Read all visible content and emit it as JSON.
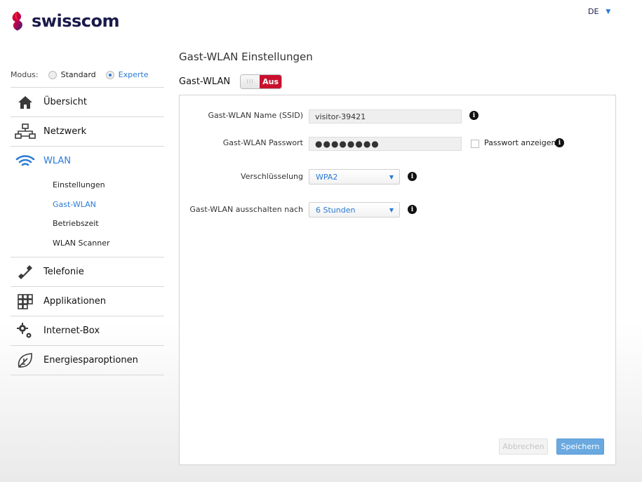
{
  "brand": {
    "name": "swisscom"
  },
  "lang": {
    "current": "DE"
  },
  "mode": {
    "label": "Modus:",
    "standard": "Standard",
    "expert": "Experte",
    "selected": "expert"
  },
  "sidebar": {
    "items": [
      {
        "label": "Übersicht",
        "icon": "home-icon"
      },
      {
        "label": "Netzwerk",
        "icon": "network-icon"
      },
      {
        "label": "WLAN",
        "icon": "wifi-icon",
        "active": true,
        "subitems": [
          {
            "label": "Einstellungen"
          },
          {
            "label": "Gast-WLAN",
            "active": true
          },
          {
            "label": "Betriebszeit"
          },
          {
            "label": "WLAN Scanner"
          }
        ]
      },
      {
        "label": "Telefonie",
        "icon": "phone-icon"
      },
      {
        "label": "Applikationen",
        "icon": "apps-icon"
      },
      {
        "label": "Internet-Box",
        "icon": "gears-icon"
      },
      {
        "label": "Energiesparoptionen",
        "icon": "leaf-icon"
      }
    ]
  },
  "main": {
    "title": "Gast-WLAN Einstellungen",
    "toggle": {
      "label": "Gast-WLAN",
      "state": "Aus",
      "knob": "III"
    },
    "form": {
      "ssid": {
        "label": "Gast-WLAN Name (SSID)",
        "value": "visitor-39421"
      },
      "password": {
        "label": "Gast-WLAN Passwort",
        "value": "●●●●●●●●",
        "show_label": "Passwort anzeigen"
      },
      "encryption": {
        "label": "Verschlüsselung",
        "value": "WPA2"
      },
      "timeout": {
        "label": "Gast-WLAN ausschalten nach",
        "value": "6 Stunden"
      },
      "info_glyph": "i"
    },
    "buttons": {
      "cancel": "Abbrechen",
      "save": "Speichern"
    }
  },
  "colors": {
    "accent": "#2b7bd6",
    "off_red": "#c8102e",
    "navy": "#1a1a4a"
  }
}
